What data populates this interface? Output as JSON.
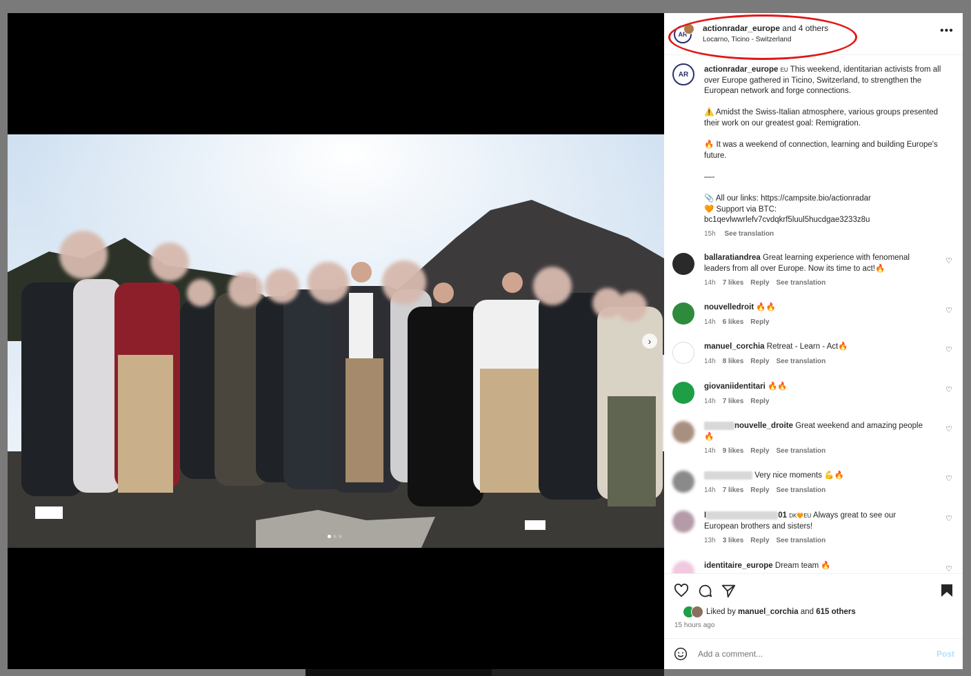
{
  "post": {
    "header": {
      "username": "actionradar_europe",
      "collab": "and 4 others",
      "location": "Locarno, Ticino - Switzerland",
      "more_icon": "more-horizontal-icon",
      "avatar_text": "AR"
    },
    "caption": {
      "username": "actionradar_europe",
      "badge": "EU",
      "line1": "This weekend, identitarian activists from all over Europe gathered in Ticino, Switzerland, to strengthen the European network and forge connections.",
      "line2": "⚠️ Amidst the Swiss-Italian atmosphere, various groups presented their work on our greatest goal: Remigration.",
      "line3": "🔥 It was a weekend of connection, learning and building Europe's future.",
      "line4": "—-",
      "line5": "📎 All our links: https://campsite.bio/actionradar",
      "line6": "🧡 Support via BTC:",
      "line7": "bc1qevlwwrlefv7cvdqkrf5luul5hucdgae3233z8u",
      "time": "15h",
      "see_translation": "See translation"
    },
    "comments": [
      {
        "username": "ballaratiandrea",
        "text": "Great learning experience with fenomenal leaders from all over Europe. Now its time to act!🔥",
        "time": "14h",
        "likes": "7 likes",
        "reply": "Reply",
        "translation": "See translation"
      },
      {
        "username": "nouvelledroit",
        "text": "🔥🔥",
        "time": "14h",
        "likes": "6 likes",
        "reply": "Reply"
      },
      {
        "username": "manuel_corchia",
        "text": "Retreat - Learn - Act🔥",
        "time": "14h",
        "likes": "8 likes",
        "reply": "Reply",
        "translation": "See translation"
      },
      {
        "username": "giovaniidentitari",
        "text": "🔥🔥",
        "time": "14h",
        "likes": "7 likes",
        "reply": "Reply"
      },
      {
        "username": "nouvelle_droite",
        "text": "Great weekend and amazing people 🔥",
        "time": "14h",
        "likes": "9 likes",
        "reply": "Reply",
        "translation": "See translation"
      },
      {
        "text": "Very nice moments 💪🔥",
        "time": "14h",
        "likes": "7 likes",
        "reply": "Reply",
        "translation": "See translation"
      },
      {
        "username_prefix": "I",
        "username_suffix": "01",
        "flags": "DK🧡EU",
        "text": "Always great to see our European brothers and sisters!",
        "time": "13h",
        "likes": "3 likes",
        "reply": "Reply",
        "translation": "See translation"
      },
      {
        "username": "identitaire_europe",
        "text": "Dream team 🔥"
      }
    ],
    "likes": {
      "prefix": "Liked by",
      "user": "manuel_corchia",
      "and": "and",
      "others": "615 others"
    },
    "time_ago": "15 hours ago",
    "add_comment": {
      "placeholder": "Add a comment...",
      "post": "Post"
    },
    "colors": {
      "accent": "#0095f6",
      "ring": "#e01818",
      "text": "#262626",
      "muted": "#737373"
    }
  }
}
